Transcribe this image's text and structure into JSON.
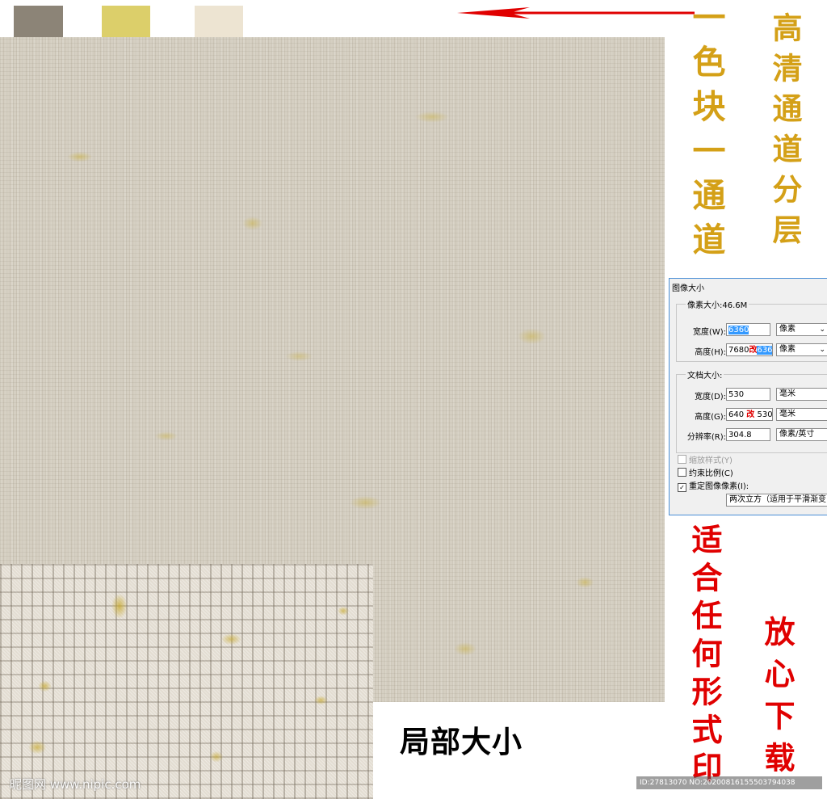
{
  "swatches": {
    "colors": [
      "#8c8477",
      "#dccf6a",
      "#ede4d2"
    ]
  },
  "texture": {
    "base_color": "#d5cfc2",
    "accent_color": "#c9b040"
  },
  "titles": {
    "left_vertical": "一色块一通道",
    "right_vertical": "高清通道分层",
    "left_color": "#d4a017"
  },
  "dialog": {
    "title": "图像大小",
    "pixel_size_label": "像素大小:46.6M",
    "width_label": "宽度(W):",
    "width_value": "6360",
    "width_unit": "像素",
    "height_label": "高度(H):",
    "height_value_old": "7680",
    "height_mark": "改",
    "height_value_new": "6360",
    "height_unit": "像素",
    "doc_size_label": "文档大小:",
    "doc_width_label": "宽度(D):",
    "doc_width_value": "530",
    "doc_width_unit": "毫米",
    "doc_height_label": "高度(G):",
    "doc_height_value_old": "640",
    "doc_height_mark": "改",
    "doc_height_value_new": "530",
    "doc_height_unit": "毫米",
    "resolution_label": "分辨率(R):",
    "resolution_value": "304.8",
    "resolution_unit": "像素/英寸",
    "scale_styles_label": "缩放样式(Y)",
    "constrain_label": "约束比例(C)",
    "resample_label": "重定图像像素(I):",
    "resample_check": "✓",
    "resample_method": "两次立方（适用于平滑渐变"
  },
  "detail": {
    "caption": "局部大小"
  },
  "red_text": {
    "left_vertical": "适合任何形式印",
    "right_vertical": "放心下载"
  },
  "watermarks": {
    "site": "昵图网 www.nipic.com",
    "id": "ID:27813070 NO:20200816155503794038"
  }
}
